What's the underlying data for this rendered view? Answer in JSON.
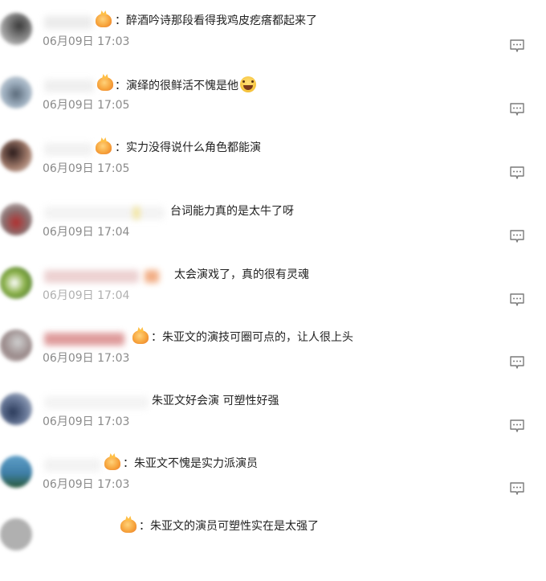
{
  "comments": [
    {
      "text": "醉酒吟诗那段看得我鸡皮疙瘩都起来了",
      "time": "06月09日 17:03"
    },
    {
      "text": "演绎的很鲜活不愧是他",
      "time": "06月09日 17:05"
    },
    {
      "text": "实力没得说什么角色都能演",
      "time": "06月09日 17:05"
    },
    {
      "text": "台词能力真的是太牛了呀",
      "time": "06月09日 17:04"
    },
    {
      "text": "太会演戏了，真的很有灵魂",
      "time": "06月09日 17:04"
    },
    {
      "text": "朱亚文的演技可圈可点的，让人很上头",
      "time": "06月09日 17:03"
    },
    {
      "text": "朱亚文好会演 可塑性好强",
      "time": "06月09日 17:03"
    },
    {
      "text": "朱亚文不愧是实力派演员",
      "time": "06月09日 17:03"
    },
    {
      "text": "朱亚文的演员可塑性实在是太强了",
      "time": ""
    }
  ],
  "icons": {
    "reply": "reply-comment-icon",
    "badge": "fan-badge-icon",
    "emoji": "grinning-emoji-icon"
  },
  "colors": {
    "text": "#222222",
    "time": "#8a8a8a",
    "icon": "#7a7a7a"
  }
}
